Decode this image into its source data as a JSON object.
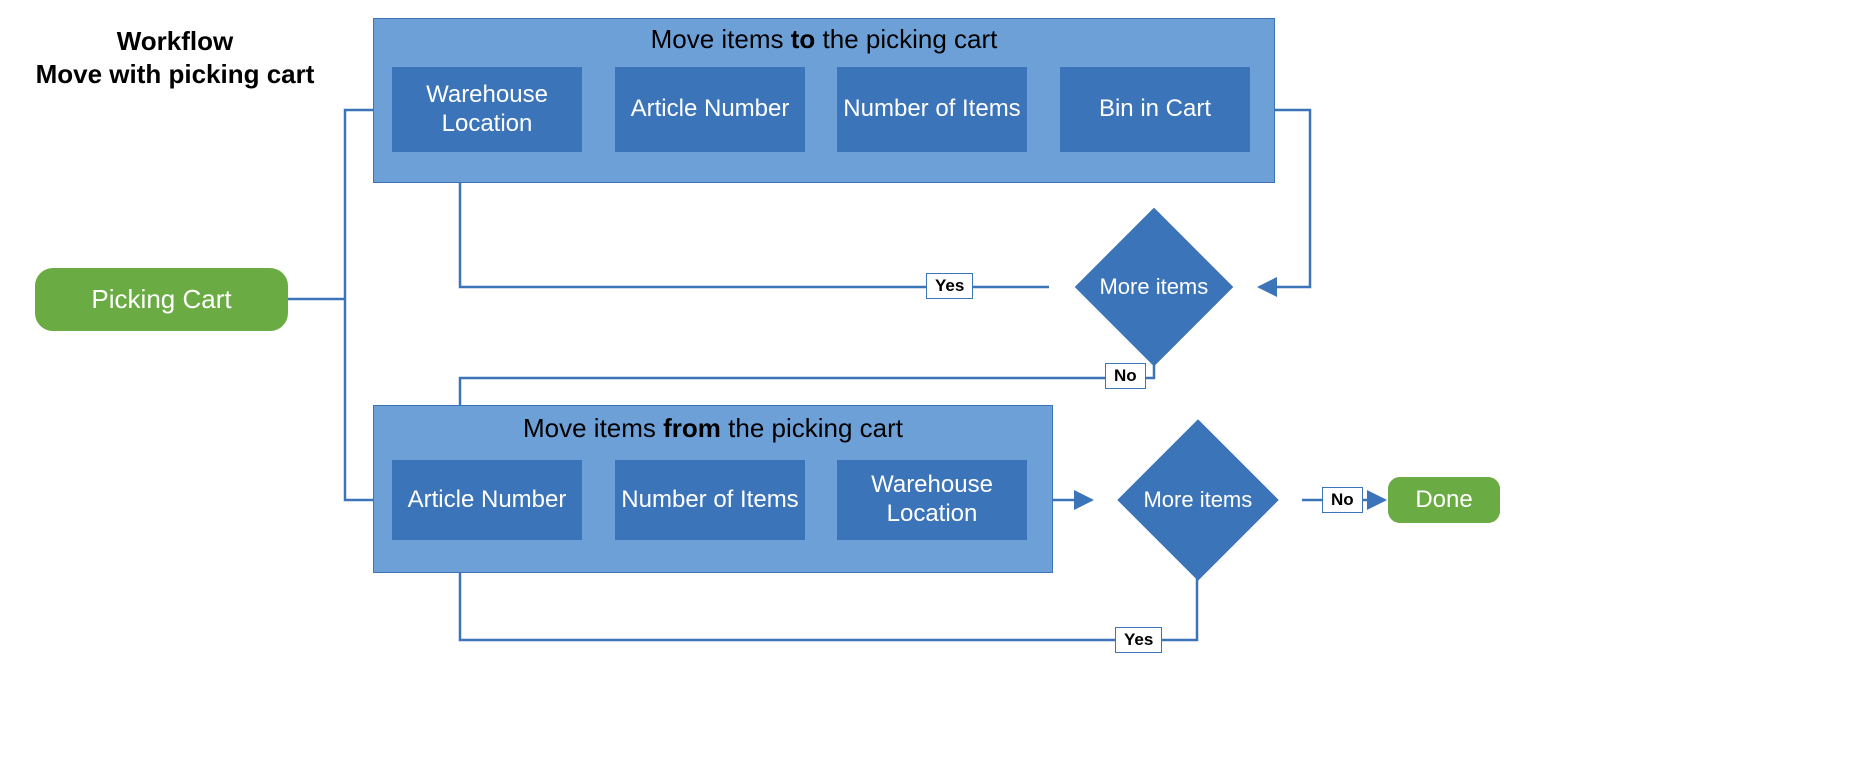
{
  "title_line1": "Workflow",
  "title_line2": "Move with picking cart",
  "start": "Picking Cart",
  "done": "Done",
  "yes": "Yes",
  "no": "No",
  "more_items": "More items",
  "panel_to": {
    "title_pre": "Move items ",
    "title_bold": "to",
    "title_post": " the picking cart",
    "steps": [
      "Warehouse Location",
      "Article Number",
      "Number of Items",
      "Bin in Cart"
    ]
  },
  "panel_from": {
    "title_pre": "Move items ",
    "title_bold": "from",
    "title_post": " the picking cart",
    "steps": [
      "Article Number",
      "Number of Items",
      "Warehouse Location"
    ]
  },
  "colors": {
    "blue": "#3c74b9",
    "panel": "#6ea0d8",
    "green": "#6aac43"
  }
}
